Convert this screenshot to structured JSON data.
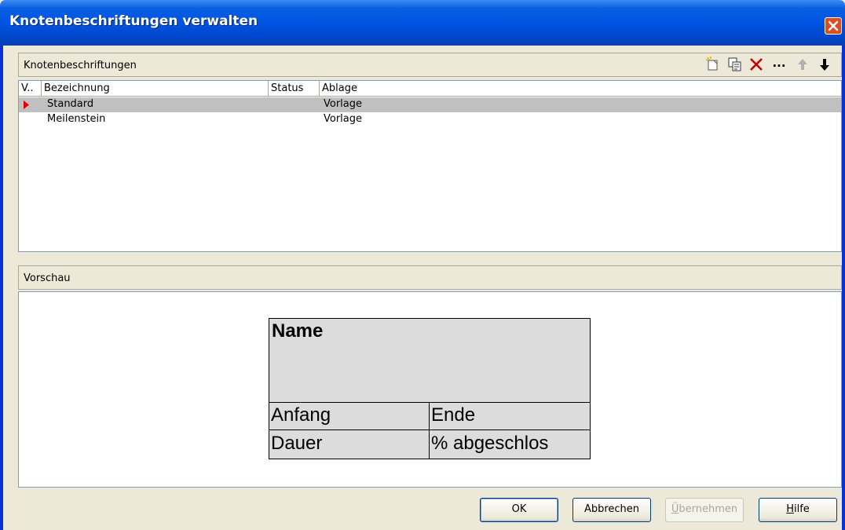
{
  "window": {
    "title": "Knotenbeschriftungen verwalten"
  },
  "list_group": {
    "header": "Knotenbeschriftungen",
    "toolbar": [
      "new-icon",
      "copy-icon",
      "delete-icon",
      "more-icon",
      "move-up-icon",
      "move-down-icon"
    ],
    "toolbar_more_label": "...",
    "columns": [
      "V..",
      "Bezeichnung",
      "Status",
      "Ablage"
    ],
    "rows": [
      {
        "marker": "current-row-arrow",
        "name": "Standard",
        "status": "",
        "storage": "Vorlage",
        "selected": true
      },
      {
        "marker": "",
        "name": "Meilenstein",
        "status": "",
        "storage": "Vorlage",
        "selected": false
      }
    ]
  },
  "preview_group": {
    "header": "Vorschau",
    "node": {
      "title": "Name",
      "fields": [
        "Anfang",
        "Ende",
        "Dauer",
        "% abgeschlos"
      ],
      "fill_color": "#dcdcdc"
    }
  },
  "buttons": {
    "ok": "OK",
    "cancel": "Abbrechen",
    "apply_mnemonic": "Ü",
    "apply_rest": "bernehmen",
    "help_mnemonic": "H",
    "help_rest": "ilfe"
  },
  "colors": {
    "selection": "#c0c0c0",
    "marker": "#e00000",
    "delete": "#c00000",
    "titlebar": "#0054e3"
  }
}
